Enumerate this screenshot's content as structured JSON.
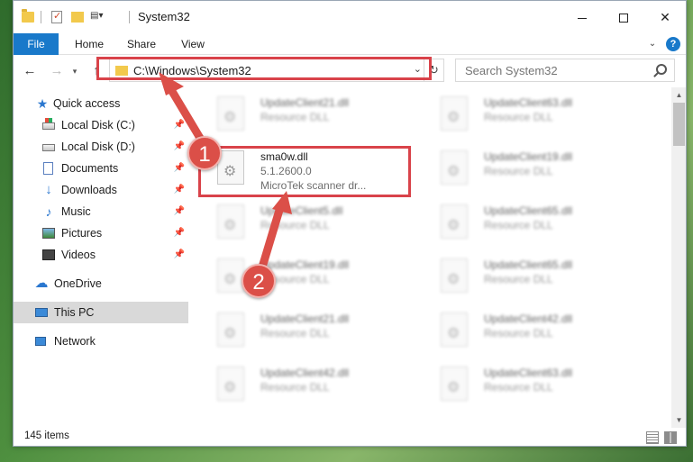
{
  "window": {
    "title": "System32",
    "controls": {
      "minimize": "minimize-icon",
      "maximize": "maximize-icon",
      "close": "✕"
    }
  },
  "ribbon": {
    "tabs": [
      {
        "label": "File"
      },
      {
        "label": "Home"
      },
      {
        "label": "Share"
      },
      {
        "label": "View"
      }
    ],
    "help": "?"
  },
  "navigation": {
    "address": "C:\\Windows\\System32",
    "search_placeholder": "Search System32"
  },
  "sidebar": {
    "items": [
      {
        "label": "Quick access",
        "icon": "star-icon",
        "pinned": false
      },
      {
        "label": "Local Disk (C:)",
        "icon": "drive-icon",
        "pinned": true
      },
      {
        "label": "Local Disk (D:)",
        "icon": "drive-icon",
        "pinned": true
      },
      {
        "label": "Documents",
        "icon": "documents-icon",
        "pinned": true
      },
      {
        "label": "Downloads",
        "icon": "download-icon",
        "pinned": true
      },
      {
        "label": "Music",
        "icon": "music-icon",
        "pinned": true
      },
      {
        "label": "Pictures",
        "icon": "pictures-icon",
        "pinned": true
      },
      {
        "label": "Videos",
        "icon": "videos-icon",
        "pinned": true
      },
      {
        "label": "OneDrive",
        "icon": "cloud-icon",
        "pinned": false
      },
      {
        "label": "This PC",
        "icon": "computer-icon",
        "pinned": false,
        "selected": true
      },
      {
        "label": "Network",
        "icon": "network-icon",
        "pinned": false
      }
    ]
  },
  "files": {
    "left_column": [
      {
        "name": "UpdateClient21.dll",
        "type": "Resource DLL"
      },
      {
        "name": "sma0w.dll",
        "version": "5.1.2600.0",
        "description": "MicroTek scanner dr...",
        "highlighted": true
      },
      {
        "name": "UpdateClient5.dll",
        "type": "Resource DLL"
      },
      {
        "name": "UpdateClient19.dll",
        "type": "Resource DLL"
      },
      {
        "name": "UpdateClient21.dll",
        "type": "Resource DLL"
      },
      {
        "name": "UpdateClient42.dll",
        "type": "Resource DLL"
      }
    ],
    "right_column": [
      {
        "name": "UpdateClient63.dll",
        "type": "Resource DLL"
      },
      {
        "name": "UpdateClient19.dll",
        "type": "Resource DLL"
      },
      {
        "name": "UpdateClient65.dll",
        "type": "Resource DLL"
      },
      {
        "name": "UpdateClient65.dll",
        "type": "Resource DLL"
      },
      {
        "name": "UpdateClient42.dll",
        "type": "Resource DLL"
      },
      {
        "name": "UpdateClient63.dll",
        "type": "Resource DLL"
      }
    ]
  },
  "status": {
    "item_count": "145 items"
  },
  "annotations": {
    "step1": "1",
    "step2": "2",
    "accent": "#d9434a"
  }
}
